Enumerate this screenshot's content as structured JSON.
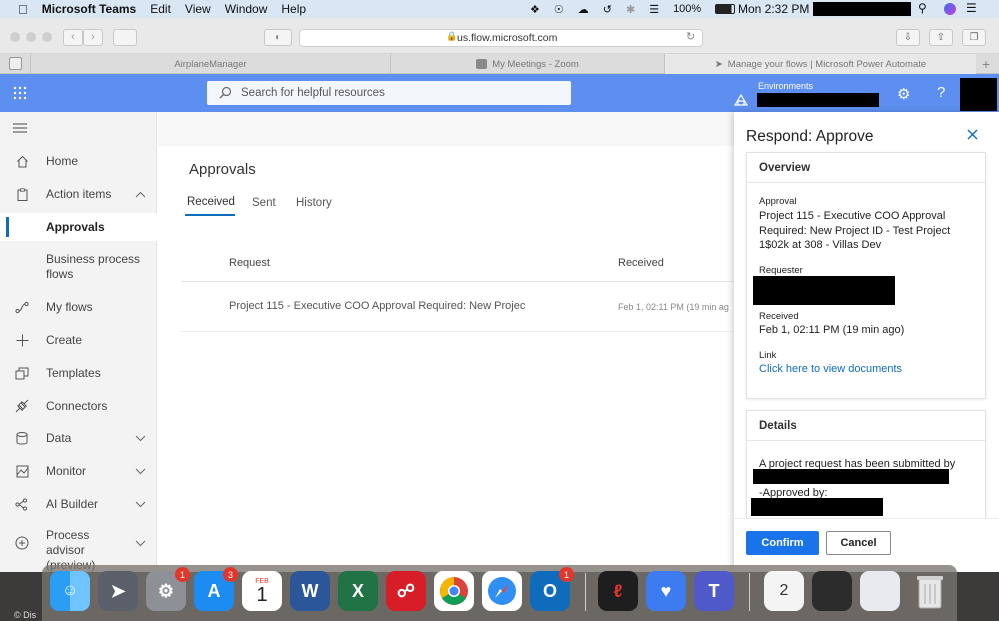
{
  "menubar": {
    "app_name": "Microsoft Teams",
    "menus": [
      "Edit",
      "View",
      "Window",
      "Help"
    ],
    "battery": "100%",
    "clock": "Mon 2:32 PM"
  },
  "browser": {
    "url": "us.flow.microsoft.com",
    "tabs": [
      {
        "title": "AirplaneManager"
      },
      {
        "title": "My Meetings - Zoom"
      },
      {
        "title": "Manage your flows | Microsoft Power Automate"
      }
    ]
  },
  "header": {
    "search_placeholder": "Search for helpful resources",
    "environments_label": "Environments",
    "help_label": "?"
  },
  "sidebar": {
    "items": [
      {
        "label": "Home",
        "icon": "home-icon"
      },
      {
        "label": "Action items",
        "icon": "clipboard-icon",
        "chevron": "up"
      },
      {
        "label": "Approvals",
        "icon": "",
        "selected": true
      },
      {
        "label": "Business process flows",
        "icon": ""
      },
      {
        "label": "My flows",
        "icon": "flow-icon"
      },
      {
        "label": "Create",
        "icon": "plus-icon"
      },
      {
        "label": "Templates",
        "icon": "templates-icon"
      },
      {
        "label": "Connectors",
        "icon": "connector-icon"
      },
      {
        "label": "Data",
        "icon": "database-icon",
        "chevron": "down"
      },
      {
        "label": "Monitor",
        "icon": "monitor-icon",
        "chevron": "down"
      },
      {
        "label": "AI Builder",
        "icon": "ai-builder-icon",
        "chevron": "down"
      },
      {
        "label": "Process advisor (preview)",
        "icon": "process-advisor-icon",
        "chevron": "down"
      }
    ]
  },
  "main": {
    "title": "Approvals",
    "tabs": [
      {
        "label": "Received",
        "active": true
      },
      {
        "label": "Sent"
      },
      {
        "label": "History"
      }
    ],
    "columns": [
      "Request",
      "Received"
    ],
    "rows": [
      {
        "request": "Project 115 - Executive COO Approval Required: New Projec",
        "received": "Feb 1, 02:11 PM (19 min ag"
      }
    ]
  },
  "panel": {
    "title": "Respond: Approve",
    "overview": {
      "heading": "Overview",
      "approval_label": "Approval",
      "approval_value": "Project 115 - Executive COO Approval Required: New Project ID - Test Project 1$02k at 308 - Villas Dev",
      "requester_label": "Requester",
      "received_label": "Received",
      "received_value": "Feb 1, 02:11 PM (19 min ago)",
      "link_label": "Link",
      "link_text": "Click here to view documents"
    },
    "details": {
      "heading": "Details",
      "line1": "A project request has been submitted by",
      "line2": "-Approved by:"
    },
    "confirm_label": "Confirm",
    "cancel_label": "Cancel"
  },
  "dock": {
    "calendar_month": "FEB",
    "calendar_day": "1",
    "badges": {
      "system_preferences": "1",
      "app_store": "3",
      "outlook": "1"
    }
  },
  "footer_text": "© Dis",
  "colors": {
    "accent": "#0f6cbd",
    "header": "#5d8ff0",
    "confirm": "#1a73e8"
  }
}
